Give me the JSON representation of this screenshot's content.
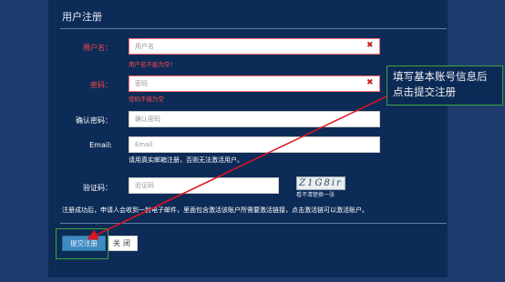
{
  "form": {
    "title": "用户注册",
    "username": {
      "label": "用户名：",
      "placeholder": "用户名",
      "error": "用户名不能为空！"
    },
    "password": {
      "label": "密码：",
      "placeholder": "密码",
      "error": "密码不能为空"
    },
    "confirm_password": {
      "label": "确认密码：",
      "placeholder": "确认密码"
    },
    "email": {
      "label": "Email:",
      "placeholder": "Email",
      "hint": "请用真实邮箱注册，否则无法激活用户。"
    },
    "captcha": {
      "label": "验证码：",
      "placeholder": "验证码",
      "image_text": "Z1G8ir",
      "refresh_text": "看不清楚换一张"
    },
    "notice": "注册成功后，申请人会收到一封电子邮件，里面包含激活该账户所需要激活链接，点击激活链可以激活账户。",
    "submit_label": "提交注册",
    "close_label": "关闭"
  },
  "annotation": {
    "line1": "填写基本账号信息后",
    "line2": "点击提交注册"
  },
  "colors": {
    "page_bg": "#1e3d6e",
    "panel_bg": "#0d2b57",
    "error_red": "#ff4a4a",
    "highlight_green": "#3aa53a",
    "arrow_red": "#e0141e",
    "submit_blue": "#3f8bc3"
  }
}
